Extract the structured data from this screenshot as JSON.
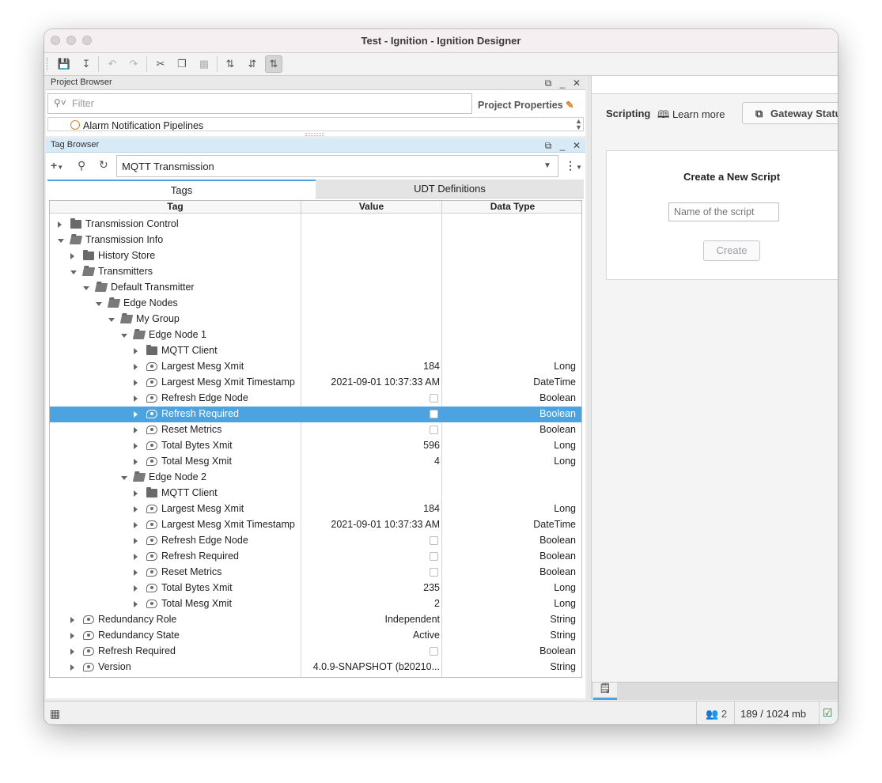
{
  "window": {
    "title": "Test - Ignition - Ignition Designer"
  },
  "project_browser": {
    "title": "Project Browser",
    "filter_placeholder": "Filter",
    "properties_label": "Project Properties",
    "partial_item": "Alarm Notification Pipelines"
  },
  "tag_browser": {
    "title": "Tag Browser",
    "provider": "MQTT Transmission",
    "tabs": [
      "Tags",
      "UDT Definitions"
    ],
    "columns": [
      "Tag",
      "Value",
      "Data Type"
    ],
    "rows": [
      {
        "depth": 0,
        "kind": "folder",
        "state": "closed",
        "name": "Transmission Control",
        "value": "",
        "type": ""
      },
      {
        "depth": 0,
        "kind": "folder",
        "state": "open",
        "name": "Transmission Info",
        "value": "",
        "type": ""
      },
      {
        "depth": 1,
        "kind": "folder",
        "state": "closed",
        "name": "History Store",
        "value": "",
        "type": ""
      },
      {
        "depth": 1,
        "kind": "folder",
        "state": "open",
        "name": "Transmitters",
        "value": "",
        "type": ""
      },
      {
        "depth": 2,
        "kind": "folder",
        "state": "open",
        "name": "Default Transmitter",
        "value": "",
        "type": ""
      },
      {
        "depth": 3,
        "kind": "folder",
        "state": "open",
        "name": "Edge Nodes",
        "value": "",
        "type": ""
      },
      {
        "depth": 4,
        "kind": "folder",
        "state": "open",
        "name": "My Group",
        "value": "",
        "type": ""
      },
      {
        "depth": 5,
        "kind": "folder",
        "state": "open",
        "name": "Edge Node 1",
        "value": "",
        "type": ""
      },
      {
        "depth": 6,
        "kind": "folder",
        "state": "closed",
        "name": "MQTT Client",
        "value": "",
        "type": ""
      },
      {
        "depth": 6,
        "kind": "tag",
        "state": "closed",
        "name": "Largest Mesg Xmit",
        "value": "184",
        "type": "Long"
      },
      {
        "depth": 6,
        "kind": "tag",
        "state": "closed",
        "name": "Largest Mesg Xmit Timestamp",
        "value": "2021-09-01 10:37:33 AM",
        "type": "DateTime"
      },
      {
        "depth": 6,
        "kind": "tag",
        "state": "closed",
        "name": "Refresh Edge Node",
        "value": "",
        "checkbox": true,
        "type": "Boolean"
      },
      {
        "depth": 6,
        "kind": "tag",
        "state": "closed",
        "name": "Refresh Required",
        "value": "",
        "checkbox": true,
        "type": "Boolean",
        "selected": true
      },
      {
        "depth": 6,
        "kind": "tag",
        "state": "closed",
        "name": "Reset Metrics",
        "value": "",
        "checkbox": true,
        "type": "Boolean"
      },
      {
        "depth": 6,
        "kind": "tag",
        "state": "closed",
        "name": "Total Bytes Xmit",
        "value": "596",
        "type": "Long"
      },
      {
        "depth": 6,
        "kind": "tag",
        "state": "closed",
        "name": "Total Mesg Xmit",
        "value": "4",
        "type": "Long"
      },
      {
        "depth": 5,
        "kind": "folder",
        "state": "open",
        "name": "Edge Node 2",
        "value": "",
        "type": ""
      },
      {
        "depth": 6,
        "kind": "folder",
        "state": "closed",
        "name": "MQTT Client",
        "value": "",
        "type": ""
      },
      {
        "depth": 6,
        "kind": "tag",
        "state": "closed",
        "name": "Largest Mesg Xmit",
        "value": "184",
        "type": "Long"
      },
      {
        "depth": 6,
        "kind": "tag",
        "state": "closed",
        "name": "Largest Mesg Xmit Timestamp",
        "value": "2021-09-01 10:37:33 AM",
        "type": "DateTime"
      },
      {
        "depth": 6,
        "kind": "tag",
        "state": "closed",
        "name": "Refresh Edge Node",
        "value": "",
        "checkbox": true,
        "type": "Boolean"
      },
      {
        "depth": 6,
        "kind": "tag",
        "state": "closed",
        "name": "Refresh Required",
        "value": "",
        "checkbox": true,
        "type": "Boolean"
      },
      {
        "depth": 6,
        "kind": "tag",
        "state": "closed",
        "name": "Reset Metrics",
        "value": "",
        "checkbox": true,
        "type": "Boolean"
      },
      {
        "depth": 6,
        "kind": "tag",
        "state": "closed",
        "name": "Total Bytes Xmit",
        "value": "235",
        "type": "Long"
      },
      {
        "depth": 6,
        "kind": "tag",
        "state": "closed",
        "name": "Total Mesg Xmit",
        "value": "2",
        "type": "Long"
      },
      {
        "depth": 1,
        "kind": "tag",
        "state": "closed",
        "name": "Redundancy Role",
        "value": "Independent",
        "type": "String"
      },
      {
        "depth": 1,
        "kind": "tag",
        "state": "closed",
        "name": "Redundancy State",
        "value": "Active",
        "type": "String"
      },
      {
        "depth": 1,
        "kind": "tag",
        "state": "closed",
        "name": "Refresh Required",
        "value": "",
        "checkbox": true,
        "type": "Boolean"
      },
      {
        "depth": 1,
        "kind": "tag",
        "state": "closed",
        "name": "Version",
        "value": "4.0.9-SNAPSHOT (b20210...",
        "type": "String"
      }
    ]
  },
  "scripting": {
    "title": "Scripting",
    "learn_more": "Learn more",
    "gateway_status": "Gateway Status",
    "create_title": "Create a New Script",
    "name_placeholder": "Name of the script",
    "create_label": "Create"
  },
  "status_bar": {
    "users": "2",
    "memory": "189 / 1024 mb"
  }
}
